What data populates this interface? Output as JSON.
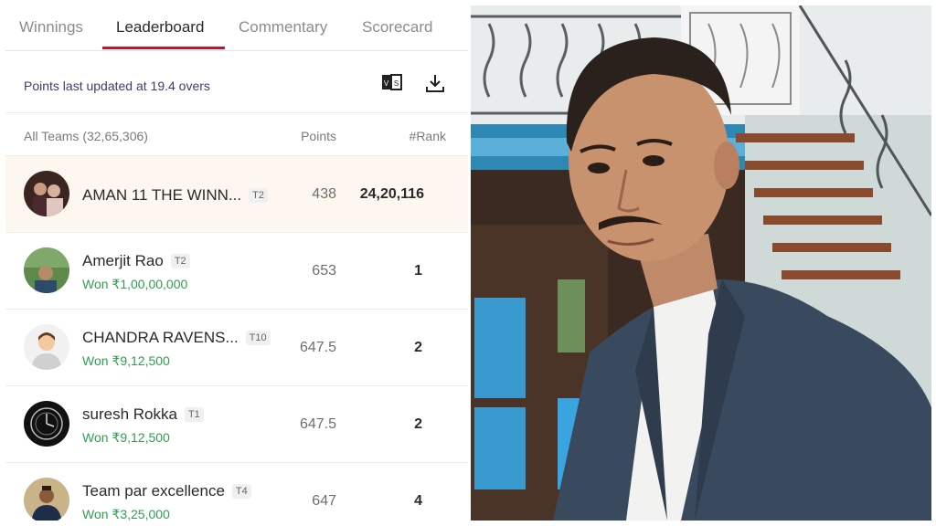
{
  "tabs": [
    {
      "label": "Winnings",
      "active": false
    },
    {
      "label": "Leaderboard",
      "active": true
    },
    {
      "label": "Commentary",
      "active": false
    },
    {
      "label": "Scorecard",
      "active": false
    }
  ],
  "status": {
    "updated_text": "Points last updated at 19.4 overs"
  },
  "toolbar": {
    "compare_icon": "compare-teams-icon",
    "download_icon": "download-icon"
  },
  "table": {
    "header_all": "All Teams (32,65,306)",
    "header_points": "Points",
    "header_rank": "#Rank"
  },
  "rows": [
    {
      "name": "AMAN 11 THE WINN...",
      "team": "T2",
      "won": "",
      "points": "438",
      "rank": "24,20,116",
      "highlight": true
    },
    {
      "name": "Amerjit Rao",
      "team": "T2",
      "won": "Won ₹1,00,00,000",
      "points": "653",
      "rank": "1"
    },
    {
      "name": "CHANDRA RAVENS...",
      "team": "T10",
      "won": "Won ₹9,12,500",
      "points": "647.5",
      "rank": "2"
    },
    {
      "name": "suresh Rokka",
      "team": "T1",
      "won": "Won ₹9,12,500",
      "points": "647.5",
      "rank": "2"
    },
    {
      "name": "Team par excellence",
      "team": "T4",
      "won": "Won ₹3,25,000",
      "points": "647",
      "rank": "4"
    }
  ],
  "colors": {
    "accent": "#c8102e",
    "won_green": "#2e9e4f",
    "highlight_bg": "#fdf7f0"
  }
}
